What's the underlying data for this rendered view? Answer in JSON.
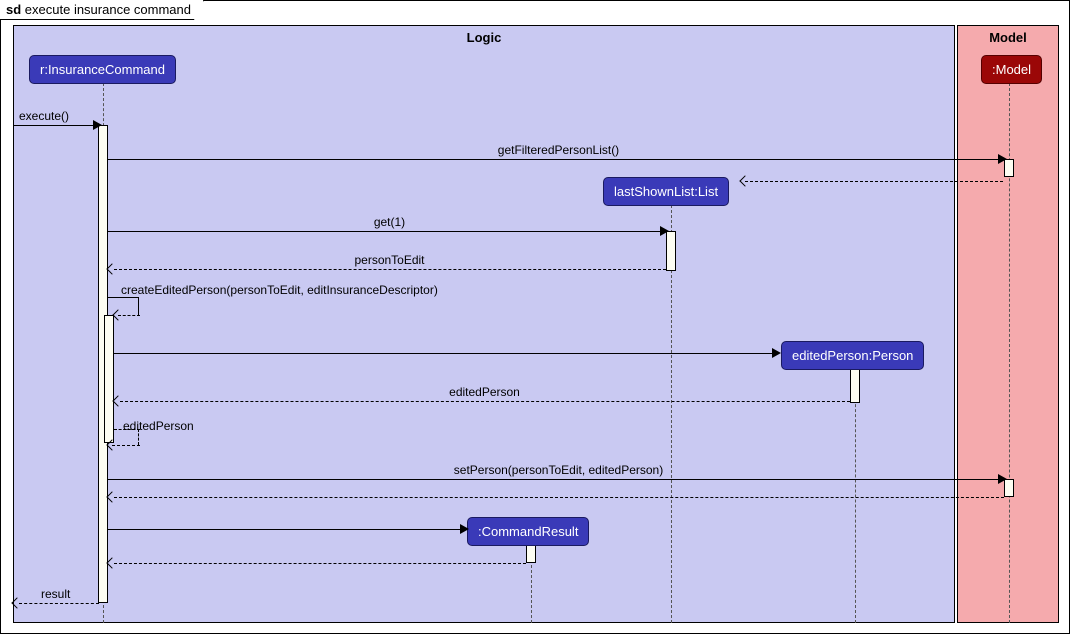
{
  "frame": {
    "sd_label": "sd",
    "title": "execute insurance command"
  },
  "regions": {
    "logic": "Logic",
    "model": "Model"
  },
  "participants": {
    "insuranceCommand": "r:InsuranceCommand",
    "model": ":Model",
    "lastShownList": "lastShownList:List",
    "editedPerson": "editedPerson:Person",
    "commandResult": ":CommandResult"
  },
  "messages": {
    "execute": "execute()",
    "getFilteredPersonList": "getFilteredPersonList()",
    "get1": "get(1)",
    "personToEdit": "personToEdit",
    "createEditedPerson": "createEditedPerson(personToEdit, editInsuranceDescriptor)",
    "editedPersonReturn": "editedPerson",
    "editedPersonSelf": "editedPerson",
    "setPerson": "setPerson(personToEdit, editedPerson)",
    "result": "result"
  },
  "chart_data": {
    "type": "sequence_diagram",
    "frame": "sd execute insurance command",
    "regions": [
      "Logic",
      "Model"
    ],
    "participants": [
      {
        "name": "r:InsuranceCommand",
        "region": "Logic"
      },
      {
        "name": ":Model",
        "region": "Model"
      },
      {
        "name": "lastShownList:List",
        "region": "Logic",
        "created_by": "getFilteredPersonList() return"
      },
      {
        "name": "editedPerson:Person",
        "region": "Logic",
        "created_by": "createEditedPerson"
      },
      {
        "name": ":CommandResult",
        "region": "Logic",
        "created_by": "r:InsuranceCommand"
      }
    ],
    "messages": [
      {
        "from": "caller",
        "to": "r:InsuranceCommand",
        "label": "execute()",
        "type": "sync"
      },
      {
        "from": "r:InsuranceCommand",
        "to": ":Model",
        "label": "getFilteredPersonList()",
        "type": "sync"
      },
      {
        "from": ":Model",
        "to": "lastShownList:List",
        "label": "",
        "type": "return_create"
      },
      {
        "from": "r:InsuranceCommand",
        "to": "lastShownList:List",
        "label": "get(1)",
        "type": "sync"
      },
      {
        "from": "lastShownList:List",
        "to": "r:InsuranceCommand",
        "label": "personToEdit",
        "type": "return"
      },
      {
        "from": "r:InsuranceCommand",
        "to": "r:InsuranceCommand",
        "label": "createEditedPerson(personToEdit, editInsuranceDescriptor)",
        "type": "self"
      },
      {
        "from": "r:InsuranceCommand",
        "to": "editedPerson:Person",
        "label": "",
        "type": "create"
      },
      {
        "from": "editedPerson:Person",
        "to": "r:InsuranceCommand",
        "label": "editedPerson",
        "type": "return"
      },
      {
        "from": "r:InsuranceCommand",
        "to": "r:InsuranceCommand",
        "label": "editedPerson",
        "type": "self_return"
      },
      {
        "from": "r:InsuranceCommand",
        "to": ":Model",
        "label": "setPerson(personToEdit, editedPerson)",
        "type": "sync"
      },
      {
        "from": ":Model",
        "to": "r:InsuranceCommand",
        "label": "",
        "type": "return"
      },
      {
        "from": "r:InsuranceCommand",
        "to": ":CommandResult",
        "label": "",
        "type": "create"
      },
      {
        "from": ":CommandResult",
        "to": "r:InsuranceCommand",
        "label": "",
        "type": "return"
      },
      {
        "from": "r:InsuranceCommand",
        "to": "caller",
        "label": "result",
        "type": "return"
      }
    ]
  }
}
